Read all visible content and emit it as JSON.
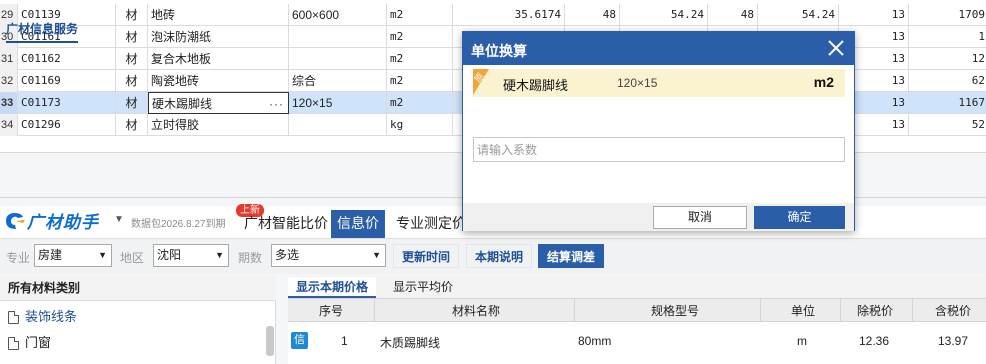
{
  "grid": {
    "rows": [
      {
        "rownum": "29",
        "code": "C01139",
        "type": "材",
        "name": "地砖",
        "spec": "600×600",
        "unit": "m2",
        "qty": "35.6174",
        "p1": "48",
        "p2": "54.24",
        "p3": "48",
        "p4": "54.24",
        "rate": "13",
        "total": "1709"
      },
      {
        "rownum": "30",
        "code": "C01161",
        "type": "材",
        "name": "泡沫防潮纸",
        "spec": "",
        "unit": "m2",
        "qty": "",
        "p1": "",
        "p2": "",
        "p3": "",
        "p4": "",
        "rate": "13",
        "total": "1"
      },
      {
        "rownum": "31",
        "code": "C01162",
        "type": "材",
        "name": "复合木地板",
        "spec": "",
        "unit": "m2",
        "qty": "",
        "p1": "",
        "p2": "",
        "p3": "",
        "p4": "",
        "rate": "13",
        "total": "12"
      },
      {
        "rownum": "32",
        "code": "C01169",
        "type": "材",
        "name": "陶瓷地砖",
        "spec": "综合",
        "unit": "m2",
        "qty": "",
        "p1": "",
        "p2": "",
        "p3": "",
        "p4": "",
        "rate": "13",
        "total": "62"
      },
      {
        "rownum": "33",
        "code": "C01173",
        "type": "材",
        "name": "硬木踢脚线",
        "spec": "120×15",
        "unit": "m2",
        "qty": "",
        "p1": "",
        "p2": "",
        "p3": "",
        "p4": "",
        "rate": "13",
        "total": "1167"
      },
      {
        "rownum": "34",
        "code": "C01296",
        "type": "材",
        "name": "立时得胶",
        "spec": "",
        "unit": "kg",
        "qty": "",
        "p1": "",
        "p2": "",
        "p3": "",
        "p4": "",
        "rate": "13",
        "total": "52"
      }
    ],
    "edit_dots": "···"
  },
  "panel": {
    "service_tab": "广材信息服务",
    "logo_text": "广材助手",
    "package_info": "数据包2026.8.27到期",
    "new_badge": "上新",
    "tabs": [
      "广材智能比价",
      "信息价",
      "专业测定价"
    ],
    "active_tab": "信息价",
    "filters": {
      "major_label": "专业",
      "major_value": "房建",
      "region_label": "地区",
      "region_value": "沈阳",
      "period_label": "期数",
      "period_value": "多选",
      "btn_update": "更新时间",
      "btn_notes": "本期说明",
      "btn_adjust": "结算调差"
    },
    "left": {
      "header": "所有材料类别",
      "items": [
        "装饰线条",
        "门窗"
      ]
    },
    "right": {
      "tab_current": "显示本期价格",
      "tab_average": "显示平均价",
      "columns": [
        "序号",
        "材料名称",
        "规格型号",
        "单位",
        "除税价",
        "含税价"
      ],
      "rows": [
        {
          "tag": "信",
          "index": "1",
          "name": "木质踢脚线",
          "spec": "80mm",
          "unit": "m",
          "pretax": "12.36",
          "taxed": "13.97"
        }
      ]
    }
  },
  "dialog": {
    "title": "单位换算",
    "material_tag": "原",
    "material_name": "硬木踢脚线",
    "material_spec": "120×15",
    "material_unit": "m2",
    "coef_placeholder": "请输入系数",
    "cancel": "取消",
    "ok": "确定"
  },
  "colors": {
    "accent": "#2b5ea8",
    "highlight_row": "#cfe3fb",
    "material_row": "#fbf3d0",
    "badge": "#e23b2e"
  }
}
